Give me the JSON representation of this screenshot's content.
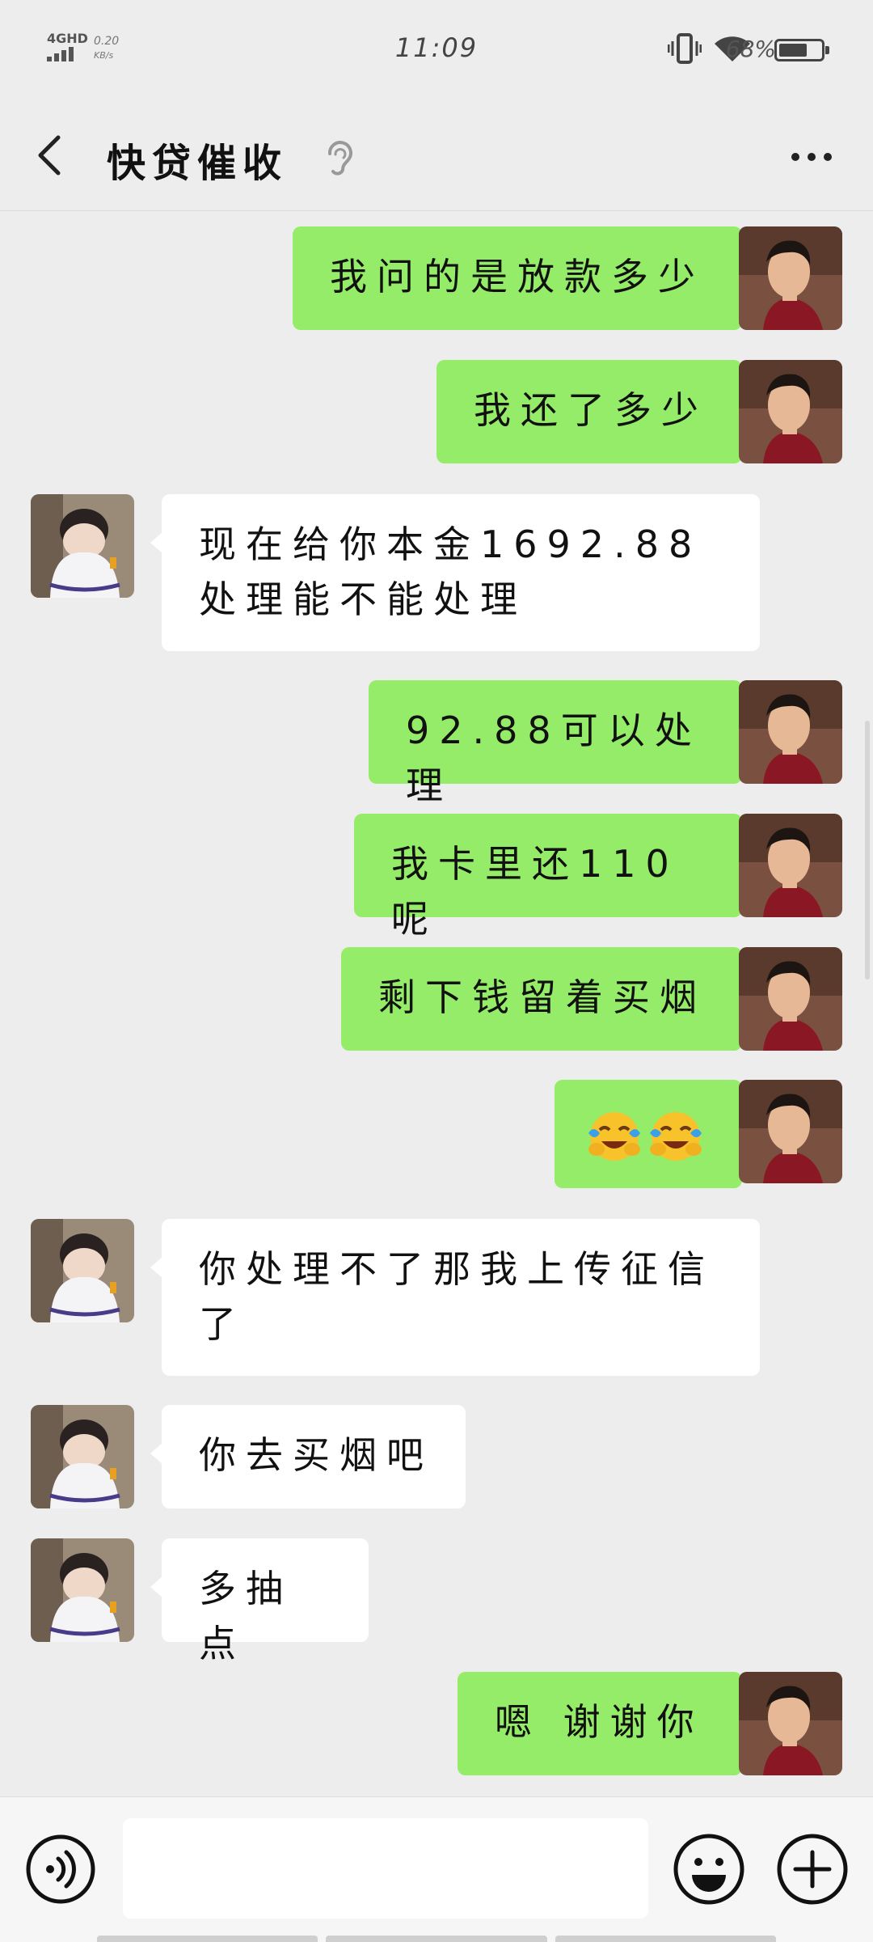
{
  "status_bar": {
    "network": "4GHD",
    "speed_value": "0.20",
    "speed_unit": "KB/s",
    "time": "11:09",
    "battery_percent": "68%",
    "battery_level": 0.68
  },
  "header": {
    "title": "快贷催收",
    "earpiece_icon": "ear-icon",
    "more_icon": "more-icon"
  },
  "messages": [
    {
      "side": "right",
      "text": "我问的是放款多少"
    },
    {
      "side": "right",
      "text": "我还了多少"
    },
    {
      "side": "left",
      "text": "现在给你本金1692.88处理能不能处理"
    },
    {
      "side": "right",
      "text": "92.88可以处理"
    },
    {
      "side": "right",
      "text": "我卡里还110呢"
    },
    {
      "side": "right",
      "text": "剩下钱留着买烟"
    },
    {
      "side": "right",
      "emoji": [
        "face-with-tears-of-joy-icon",
        "face-with-tears-of-joy-icon"
      ]
    },
    {
      "side": "left",
      "text": "你处理不了那我上传征信了"
    },
    {
      "side": "left",
      "text": "你去买烟吧"
    },
    {
      "side": "left",
      "text": "多抽点"
    },
    {
      "side": "right",
      "text": "嗯 谢谢你"
    }
  ],
  "input_bar": {
    "voice_icon": "voice-icon",
    "input_value": "",
    "emoji_icon": "smiley-icon",
    "plus_icon": "plus-icon"
  }
}
